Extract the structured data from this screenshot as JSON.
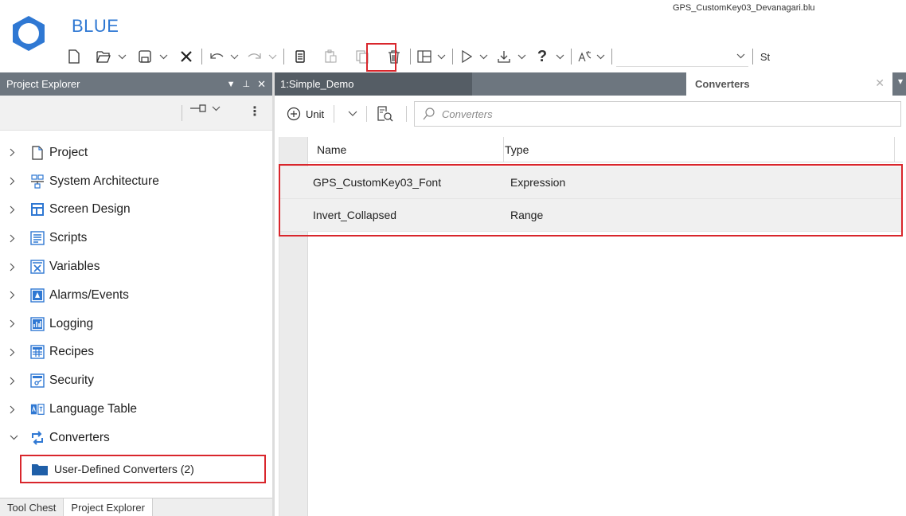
{
  "app": {
    "name": "BLUE",
    "file_name": "GPS_CustomKey03_Devanagari.blu"
  },
  "toolbar": {
    "overflow_label": "St",
    "icons": [
      "new-file-icon",
      "open-icon",
      "save-icon",
      "close-icon",
      "undo-icon",
      "redo-icon",
      "copy-icon",
      "paste-icon",
      "duplicate-icon",
      "delete-icon",
      "layout-icon",
      "run-icon",
      "download-icon",
      "help-icon",
      "translate-icon"
    ]
  },
  "project_explorer": {
    "title": "Project Explorer",
    "items": [
      {
        "label": "Project",
        "icon": "page-icon"
      },
      {
        "label": "System Architecture",
        "icon": "architecture-icon"
      },
      {
        "label": "Screen Design",
        "icon": "screen-design-icon"
      },
      {
        "label": "Scripts",
        "icon": "scripts-icon"
      },
      {
        "label": "Variables",
        "icon": "variables-icon"
      },
      {
        "label": "Alarms/Events",
        "icon": "alarms-icon"
      },
      {
        "label": "Logging",
        "icon": "logging-icon"
      },
      {
        "label": "Recipes",
        "icon": "recipes-icon"
      },
      {
        "label": "Security",
        "icon": "security-icon"
      },
      {
        "label": "Language Table",
        "icon": "language-table-icon"
      },
      {
        "label": "Converters",
        "icon": "converters-icon"
      }
    ],
    "child": {
      "label": "User-Defined Converters (2)"
    }
  },
  "bottom_tabs": [
    {
      "label": "Tool Chest"
    },
    {
      "label": "Project Explorer"
    }
  ],
  "doc_tabs": {
    "tab1": "1:Simple_Demo",
    "tab2": "Converters",
    "tab2_close": "✕",
    "menu": "▾"
  },
  "editor_toolbar": {
    "add_label": "Unit",
    "search_placeholder": "Converters"
  },
  "grid": {
    "columns": [
      "Name",
      "Type"
    ],
    "rows": [
      {
        "name": "GPS_CustomKey03_Font",
        "type": "Expression"
      },
      {
        "name": "Invert_Collapsed",
        "type": "Range"
      }
    ]
  },
  "colors": {
    "accent": "#2f78d3",
    "highlight_red": "#d9262c",
    "header_gray": "#6d767f",
    "tab_dark": "#555d65",
    "folder_blue": "#1f5fa8"
  }
}
